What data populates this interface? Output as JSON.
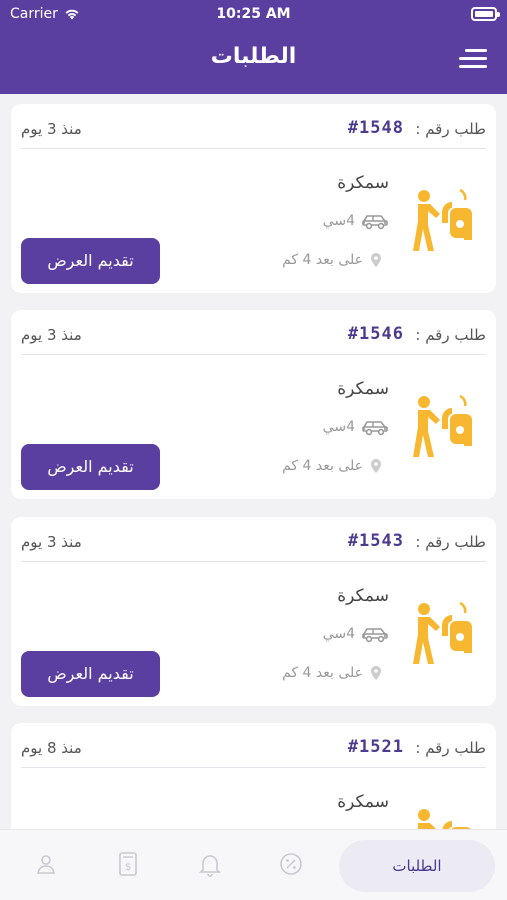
{
  "status_bar": {
    "carrier": "Carrier",
    "time": "10:25 AM"
  },
  "header": {
    "title": "الطلبات"
  },
  "orders": [
    {
      "order_label": "طلب رقم :",
      "number": "#1548",
      "since": "منذ 3 يوم",
      "service": "سمكرة",
      "car": "4سي",
      "distance": "على بعد 4 كم",
      "offer_button": "تقديم العرض"
    },
    {
      "order_label": "طلب رقم :",
      "number": "#1546",
      "since": "منذ 3 يوم",
      "service": "سمكرة",
      "car": "4سي",
      "distance": "على بعد 4 كم",
      "offer_button": "تقديم العرض"
    },
    {
      "order_label": "طلب رقم :",
      "number": "#1543",
      "since": "منذ 3 يوم",
      "service": "سمكرة",
      "car": "4سي",
      "distance": "على بعد 4 كم",
      "offer_button": "تقديم العرض"
    },
    {
      "order_label": "طلب رقم :",
      "number": "#1521",
      "since": "منذ 8 يوم",
      "service": "سمكرة"
    }
  ],
  "tabbar": {
    "active_tab": "الطلبات",
    "icons": [
      "profile-icon",
      "invoice-icon",
      "bell-icon",
      "discount-icon"
    ]
  },
  "colors": {
    "primary": "#5b3fa0",
    "accent": "#f7b731",
    "order_number": "#4d3a8f"
  }
}
